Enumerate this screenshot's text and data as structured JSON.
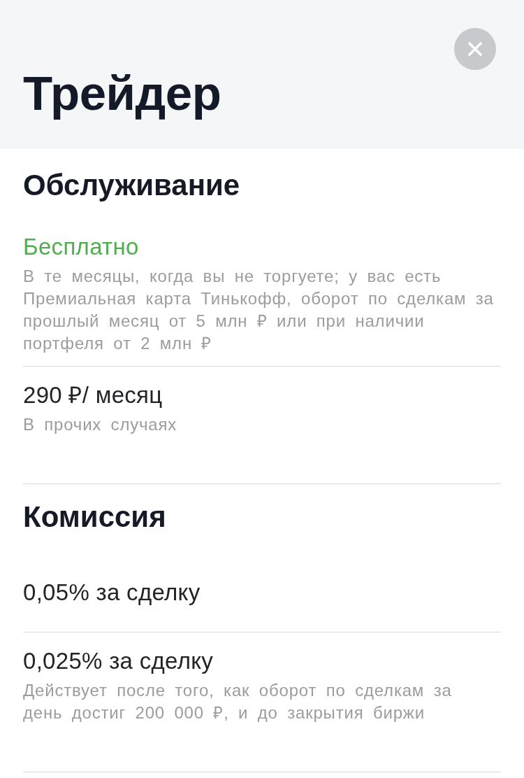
{
  "header": {
    "title": "Трейдер"
  },
  "sections": [
    {
      "heading": "Обслуживание",
      "items": [
        {
          "kind": "accent",
          "value": "Бесплатно",
          "note": "В те месяцы, когда вы не торгуете; у вас есть Премиальная карта Тинькофф, оборот по сделкам за прошлый месяц от 5 млн ₽ или при наличии портфеля от 2 млн ₽"
        },
        {
          "kind": "plain",
          "value": "290 ₽/ месяц",
          "note": "В прочих случаях"
        }
      ]
    },
    {
      "heading": "Комиссия",
      "items": [
        {
          "kind": "plain",
          "value": "0,05% за сделку"
        },
        {
          "kind": "plain",
          "value": "0,025% за сделку",
          "note": "Действует после того, как оборот по сделкам за день достиг 200 000 ₽, и до закрытия биржи"
        }
      ]
    }
  ]
}
